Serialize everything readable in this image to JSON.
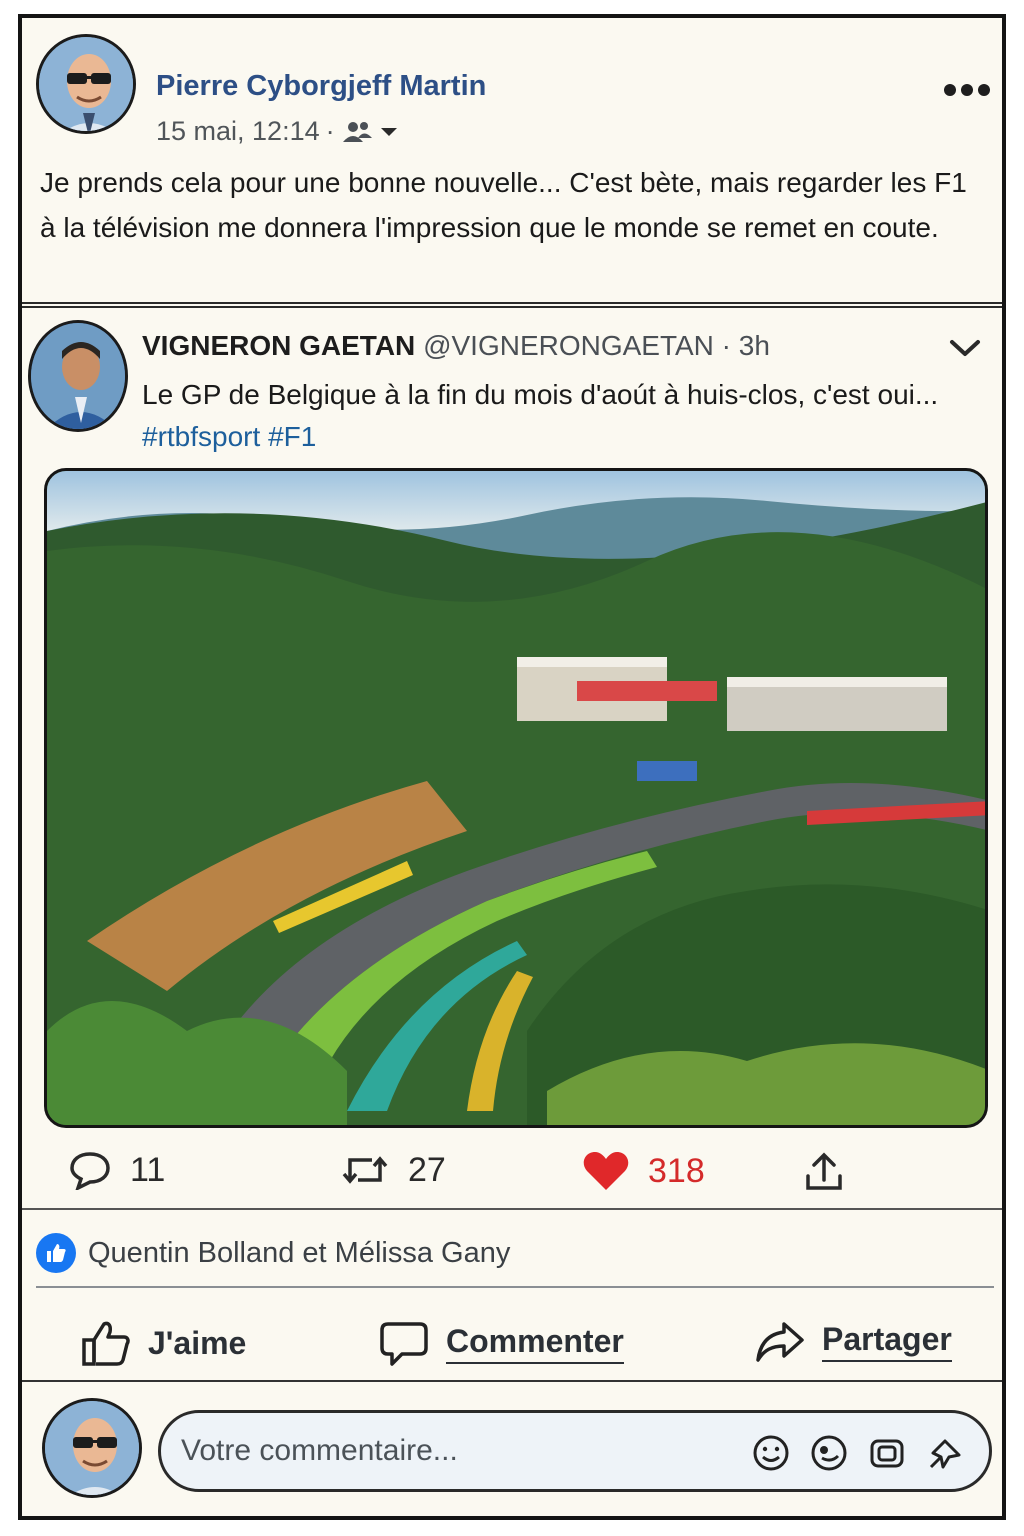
{
  "post": {
    "author": "Pierre Cyborgjeff Martin",
    "timestamp": "15 mai, 12:14",
    "separator": "·",
    "audience_icon": "friends-icon",
    "text": "Je prends cela pour une bonne nouvelle... C'est bète, mais regarder les F1 à la télévision me donnera l'impression que le monde se remet en coute."
  },
  "tweet": {
    "name": "VIGNERON GAETAN",
    "handle": "@VIGNERONGAETAN",
    "time": "· 3h",
    "text": "Le GP de Belgique à la fin du mois d'aoút à huis-clos, c'est oui...",
    "hashtags": [
      "#rtbfsport",
      "#F1"
    ],
    "image_subject": "Spa-Francorchamps race circuit surrounded by forest",
    "stats": {
      "replies": "11",
      "retweets": "27",
      "likes": "318"
    },
    "like_color": "#d42a2a"
  },
  "reactions": {
    "text": "Quentin Bolland et Mélissa Gany",
    "icon": "thumbs-up-icon",
    "color": "#1877f2"
  },
  "actions": {
    "like": "J'aime",
    "comment": "Commenter",
    "share": "Partager"
  },
  "composer": {
    "placeholder": "Votre commentaire..."
  },
  "colors": {
    "author_name": "#2d4f86",
    "hashtag": "#1d5f9c",
    "background": "#fbf9f1"
  }
}
